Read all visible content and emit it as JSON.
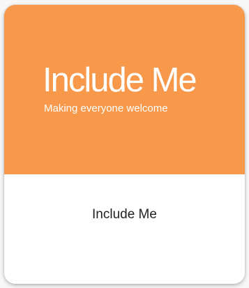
{
  "card": {
    "logo_title": "Include Me",
    "logo_tagline": "Making everyone welcome",
    "label": "Include Me"
  },
  "colors": {
    "banner": "#f7984a",
    "logo_text": "#ffffff",
    "label_text": "#1f1f1f"
  }
}
